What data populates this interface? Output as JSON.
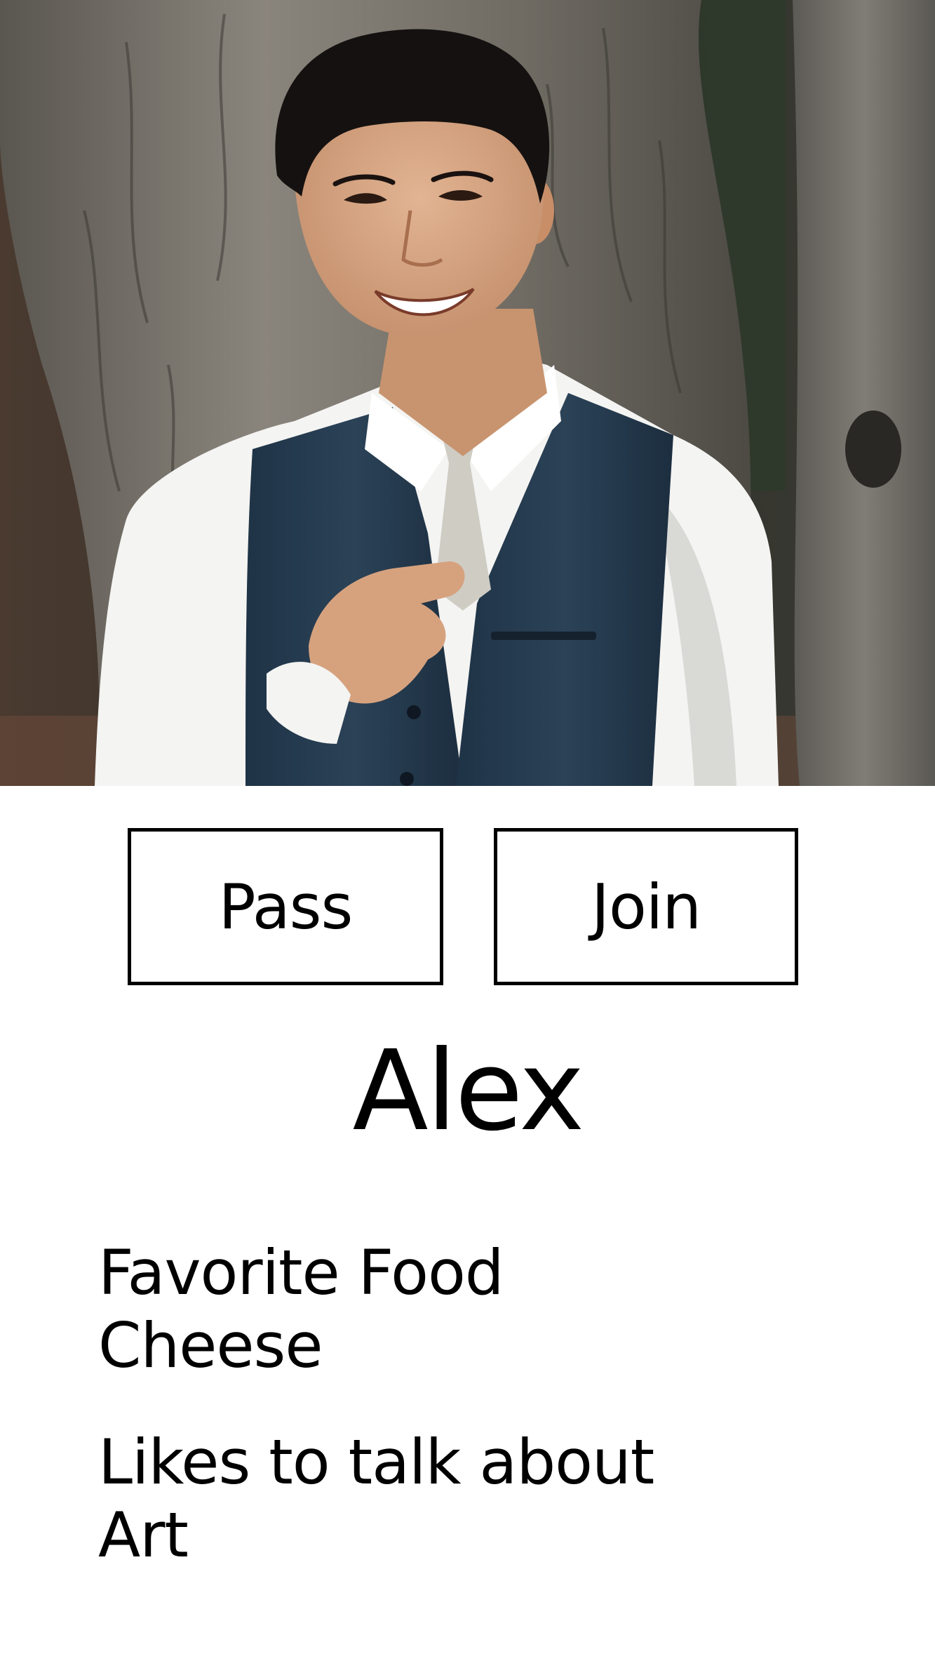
{
  "profile": {
    "photo": "profile-photo",
    "name": "Alex"
  },
  "actions": {
    "pass_label": "Pass",
    "join_label": "Join"
  },
  "details": [
    {
      "label": "Favorite Food",
      "value": "Cheese"
    },
    {
      "label": "Likes to talk about",
      "value": "Art"
    }
  ],
  "colors": {
    "background": "#ffffff",
    "text": "#000000",
    "button_border": "#000000"
  }
}
